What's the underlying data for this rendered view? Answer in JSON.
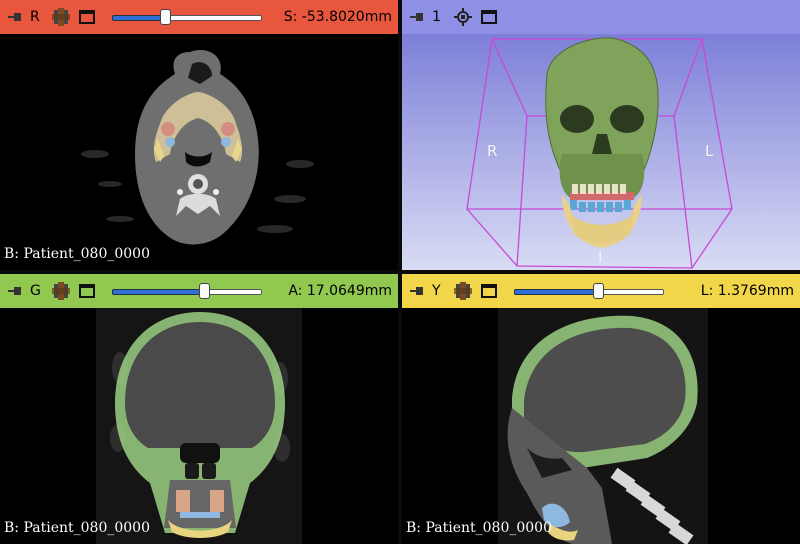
{
  "views": {
    "red": {
      "label": "R",
      "value": "S: -53.8020mm",
      "caption": "B: Patient_080_0000",
      "slider": 0.35,
      "color": "#e8563e"
    },
    "threed": {
      "label": "1",
      "color": "#8f8fe6",
      "orient_left": "R",
      "orient_right": "L",
      "orient_bottom": "I"
    },
    "green": {
      "label": "G",
      "value": "A: 17.0649mm",
      "caption": "B: Patient_080_0000",
      "slider": 0.61,
      "color": "#90c850"
    },
    "yellow": {
      "label": "Y",
      "value": "L: 1.3769mm",
      "caption": "B: Patient_080_0000",
      "slider": 0.56,
      "color": "#f2d64a"
    }
  },
  "icons": {
    "pin": "pin-icon",
    "layer": "slice-layers-icon",
    "window": "window-maximize-icon",
    "target": "center-target-icon"
  }
}
